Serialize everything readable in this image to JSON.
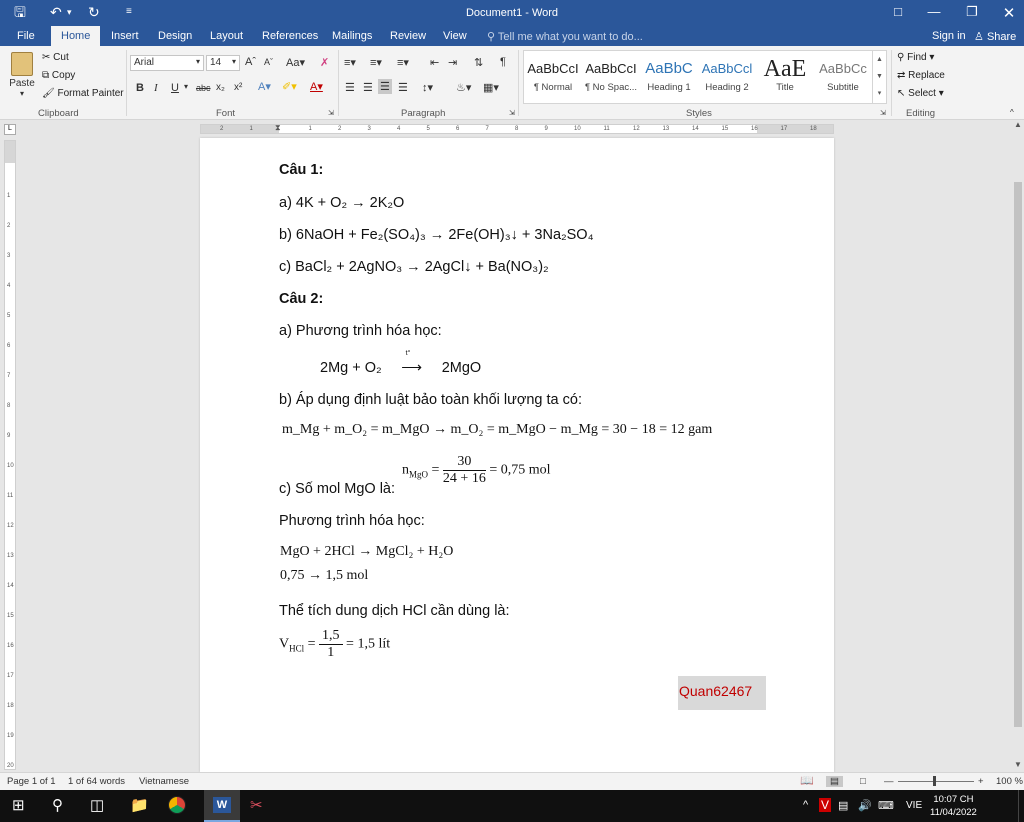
{
  "window": {
    "title": "Document1 - Word"
  },
  "quick_access": {
    "save_icon": "save-icon",
    "undo_icon": "undo-icon",
    "redo_icon": "redo-icon",
    "customize_icon": "customize-icon"
  },
  "tabs": [
    "File",
    "Home",
    "Insert",
    "Design",
    "Layout",
    "References",
    "Mailings",
    "Review",
    "View"
  ],
  "tell_me": "Tell me what you want to do...",
  "account": {
    "sign_in": "Sign in",
    "share": "Share"
  },
  "ribbon": {
    "clipboard": {
      "label": "Clipboard",
      "paste": "Paste",
      "cut": "Cut",
      "copy": "Copy",
      "format_painter": "Format Painter"
    },
    "font": {
      "label": "Font",
      "font_name": "Arial",
      "font_size": "14",
      "bold": "B",
      "italic": "I",
      "underline": "U",
      "strikethrough": "abc",
      "subscript": "x₂",
      "superscript": "x²"
    },
    "paragraph": {
      "label": "Paragraph"
    },
    "styles": {
      "label": "Styles",
      "items": [
        {
          "preview": "AaBbCcI",
          "name": "¶ Normal"
        },
        {
          "preview": "AaBbCcI",
          "name": "¶ No Spac..."
        },
        {
          "preview": "AaBbC",
          "name": "Heading 1"
        },
        {
          "preview": "AaBbCcl",
          "name": "Heading 2"
        },
        {
          "preview": "AaE",
          "name": "Title"
        },
        {
          "preview": "AaBbCc",
          "name": "Subtitle"
        }
      ]
    },
    "editing": {
      "label": "Editing",
      "find": "Find",
      "replace": "Replace",
      "select": "Select"
    }
  },
  "document": {
    "cau1": "Câu 1:",
    "l1a": "a) 4K + O₂ → 2K₂O",
    "l1b": "b) 6NaOH + Fe₂(SO₄)₃ → 2Fe(OH)₃↓ + 3Na₂SO₄",
    "l1c": "c) BaCl₂ + 2AgNO₃ → 2AgCl↓ + Ba(NO₃)₂",
    "cau2": "Câu 2:",
    "l2a": "a) Phương trình hóa học:",
    "l2a_eq_left": "2Mg + O₂",
    "l2a_eq_cond": "t°",
    "l2a_eq_right": "2MgO",
    "l2b": "b) Áp dụng định luật bảo toàn khối lượng ta có:",
    "l2b_eq": "m_Mg + m_O₂ = m_MgO → m_O₂ = m_MgO − m_Mg = 30 − 18 = 12 gam",
    "l2c": "c) Số mol MgO là:",
    "l2c_n": "n",
    "l2c_n_sub": "MgO",
    "l2c_num": "30",
    "l2c_den": "24 + 16",
    "l2c_result": "= 0,75 mol",
    "pt_label": "Phương trình hóa học:",
    "pt_eq": "MgO + 2HCl → MgCl₂ + H₂O",
    "pt_mol": "0,75 → 1,5 mol",
    "volume_label": "Thể tích dung dịch HCl cần dùng là:",
    "v": "V",
    "v_sub": "HCl",
    "v_num": "1,5",
    "v_den": "1",
    "v_result": "= 1,5 lít",
    "watermark": "Quan62467"
  },
  "status": {
    "page": "Page 1 of 1",
    "words": "1 of 64 words",
    "language": "Vietnamese",
    "zoom": "100 %"
  },
  "taskbar": {
    "language": "VIE",
    "time": "10:07 CH",
    "date": "11/04/2022"
  },
  "colors": {
    "word_blue": "#2b579a",
    "watermark_red": "#c00000"
  }
}
